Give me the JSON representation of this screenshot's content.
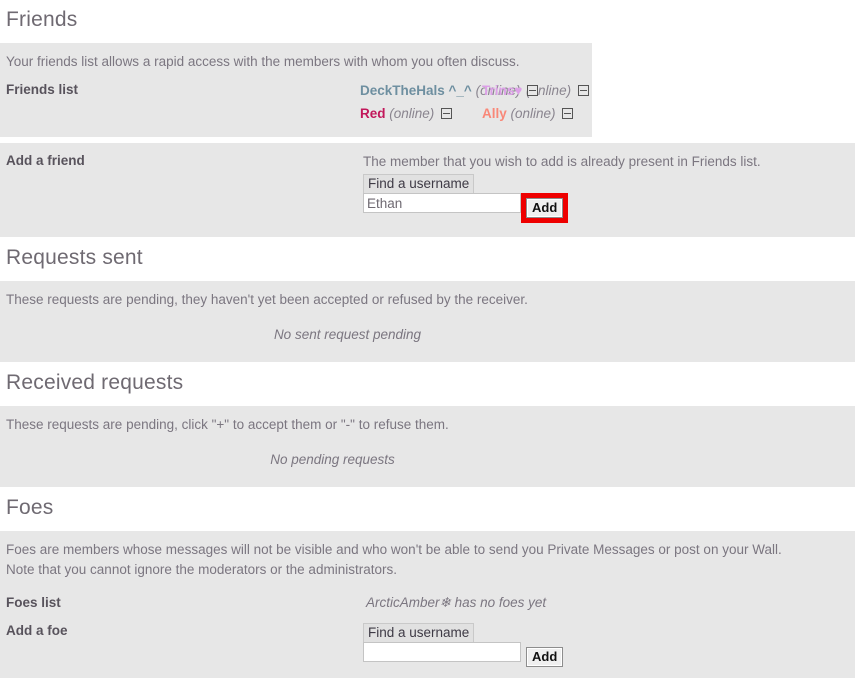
{
  "sections": {
    "friends": {
      "title": "Friends",
      "description": "Your friends list allows a rapid access with the members with whom you often discuss.",
      "list_label": "Friends list",
      "friends": [
        {
          "name": "DeckTheHals ^_^",
          "status": "(online)",
          "color": "#6e8fa0",
          "remove_icon": "minus-box-icon"
        },
        {
          "name": "Trins♥",
          "status": "(online)",
          "color": "#dda0e8",
          "remove_icon": "minus-box-icon"
        },
        {
          "name": "Red",
          "status": "(online)",
          "color": "#c2185b",
          "remove_icon": "minus-box-icon"
        },
        {
          "name": "Ally",
          "status": "(online)",
          "color": "#f98878",
          "remove_icon": "minus-box-icon"
        }
      ],
      "add_label": "Add a friend",
      "add_notice": "The member that you wish to add is already present in Friends list.",
      "find_hint": "Find a username",
      "input_value": "Ethan",
      "input_placeholder": "",
      "add_button": "Add",
      "highlight_color": "#ee0000"
    },
    "requests_sent": {
      "title": "Requests sent",
      "description": "These requests are pending, they haven't yet been accepted or refused by the receiver.",
      "empty_message": "No sent request pending"
    },
    "received_requests": {
      "title": "Received requests",
      "description": "These requests are pending, click \"+\" to accept them or \"-\" to refuse them.",
      "empty_message": "No pending requests"
    },
    "foes": {
      "title": "Foes",
      "description_line1": "Foes are members whose messages will not be visible and who won't be able to send you Private Messages or post on your Wall.",
      "description_line2": "Note that you cannot ignore the moderators or the administrators.",
      "list_label": "Foes list",
      "list_value": "ArcticAmber❄ has no foes yet",
      "add_label": "Add a foe",
      "find_hint": "Find a username",
      "input_value": "",
      "input_placeholder": "",
      "add_button": "Add"
    }
  },
  "colors": {
    "panel_background": "#e7e7e7",
    "page_background": "#ffffff",
    "text": "#6f6a72",
    "label": "#58535c"
  }
}
